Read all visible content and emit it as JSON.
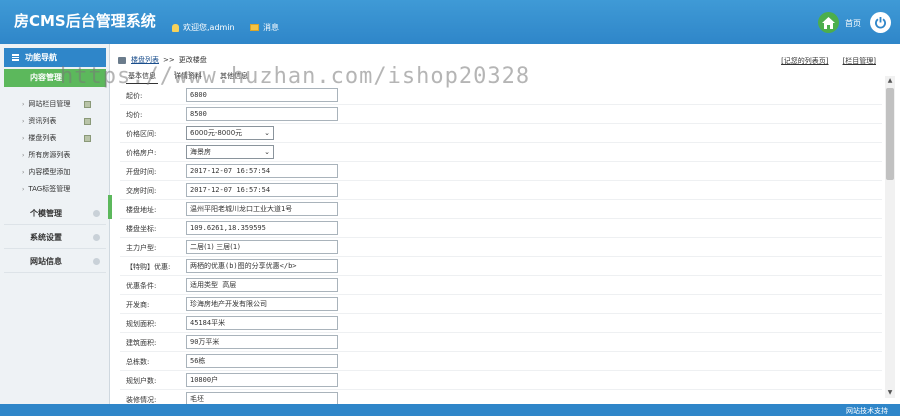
{
  "header": {
    "logo": "房CMS后台管理系统",
    "welcome": "欢迎您,admin",
    "message": "消息",
    "home": "首页"
  },
  "sidebar": {
    "title": "功能导航",
    "active_group": "内容管理",
    "items": [
      {
        "label": "网站栏目管理"
      },
      {
        "label": "资讯列表"
      },
      {
        "label": "楼盘列表"
      },
      {
        "label": "所有房源列表"
      },
      {
        "label": "内容模型添加"
      },
      {
        "label": "TAG标签管理"
      }
    ],
    "groups": [
      {
        "label": "个模管理"
      },
      {
        "label": "系统设置"
      },
      {
        "label": "网站信息"
      }
    ]
  },
  "breadcrumb": {
    "home": "楼盘列表",
    "separator": ">>",
    "current": "更改楼盘"
  },
  "toplinks": {
    "list": "[记您的列表页]",
    "manage": "[栏目管理]"
  },
  "tabs": [
    "基本信息",
    "详情资料",
    "其他信息"
  ],
  "form": {
    "rows": [
      {
        "label": "起价:",
        "type": "text",
        "value": "6800"
      },
      {
        "label": "均价:",
        "type": "text",
        "value": "8500"
      },
      {
        "label": "价格区间:",
        "type": "select",
        "value": "6000元-8000元"
      },
      {
        "label": "价格房户:",
        "type": "select",
        "value": "海景房"
      },
      {
        "label": "开盘时间:",
        "type": "text",
        "value": "2017-12-07 16:57:54"
      },
      {
        "label": "交房时间:",
        "type": "text",
        "value": "2017-12-07 16:57:54"
      },
      {
        "label": "楼盘地址:",
        "type": "text",
        "value": "温州平阳老城川龙口工业大道1号"
      },
      {
        "label": "楼盘坐标:",
        "type": "text",
        "value": "109.6261,18.359595"
      },
      {
        "label": "主力户型:",
        "type": "radio",
        "value": "二居(1) 三居(1)"
      },
      {
        "label": "【特购】优惠:",
        "type": "text",
        "value": "两栖的优惠(b)图的分享优惠</b>"
      },
      {
        "label": "优惠条件:",
        "type": "text",
        "value": "适用类型 高层"
      },
      {
        "label": "开发商:",
        "type": "text",
        "value": "珍海房地产开发有限公司"
      },
      {
        "label": "规划面积:",
        "type": "text",
        "value": "45184平米"
      },
      {
        "label": "建筑面积:",
        "type": "text",
        "value": "90万平米"
      },
      {
        "label": "总栋数:",
        "type": "text",
        "value": "56栋"
      },
      {
        "label": "规划户数:",
        "type": "text",
        "value": "10800户"
      },
      {
        "label": "装修情况:",
        "type": "text",
        "value": "毛坯"
      }
    ]
  },
  "footer": {
    "text": "网站技术支持"
  },
  "watermark": "https://www.huzhan.com/ishop20328"
}
